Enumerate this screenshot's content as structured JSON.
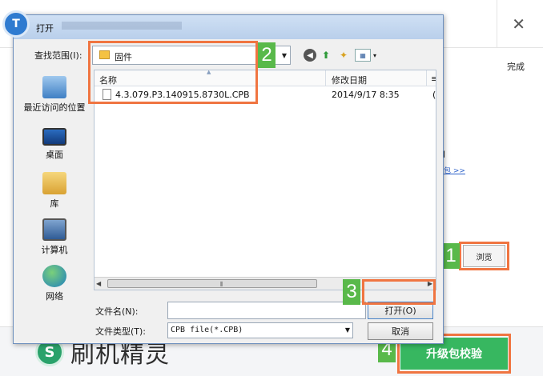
{
  "dialog": {
    "title": "打开",
    "look_in_label": "查找范围(I):",
    "look_in_value": "固件",
    "toolbar": {
      "back_icon": "back-arrow-icon",
      "up_icon": "up-folder-icon",
      "new_folder_icon": "new-folder-icon",
      "view_menu_icon": "view-menu-icon"
    },
    "places": [
      {
        "label": "最近访问的位置",
        "icon": "recent-places-icon"
      },
      {
        "label": "桌面",
        "icon": "desktop-icon"
      },
      {
        "label": "库",
        "icon": "library-icon"
      },
      {
        "label": "计算机",
        "icon": "computer-icon"
      },
      {
        "label": "网络",
        "icon": "network-icon"
      }
    ],
    "columns": {
      "name": "名称",
      "modified": "修改日期",
      "extra": "≡"
    },
    "files": [
      {
        "name": "4.3.079.P3.140915.8730L.CPB",
        "modified": "2014/9/17 8:35",
        "extra": "("
      }
    ],
    "scroll_grip": "⦀",
    "file_name_label": "文件名(N):",
    "file_name_value": "",
    "file_type_label": "文件类型(T):",
    "file_type_value": "CPB file(*.CPB)",
    "open_button": "打开(O)",
    "cancel_button": "取消"
  },
  "background_app": {
    "done_label": "完成",
    "fragment_1": "能】",
    "fragment_2": "级包 >>",
    "browse_button": "浏览",
    "brand": "刷机精灵",
    "verify_button": "升级包校验"
  },
  "steps": [
    "1",
    "2",
    "3",
    "4"
  ],
  "colors": {
    "highlight": "#f07541",
    "step_badge": "#59b94a",
    "verify_button": "#37b760"
  }
}
